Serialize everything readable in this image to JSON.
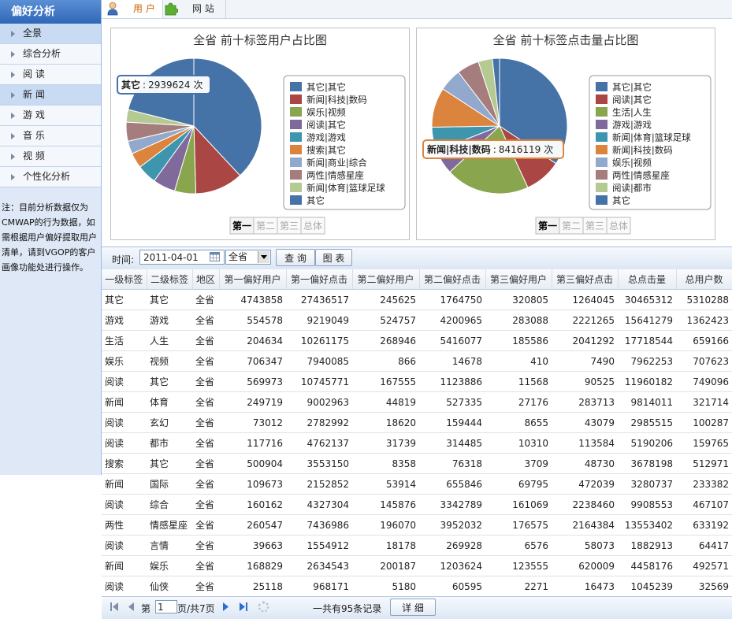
{
  "sidebar": {
    "title": "偏好分析",
    "items": [
      {
        "label": "全景",
        "active": true
      },
      {
        "label": "综合分析",
        "active": false
      },
      {
        "label": "阅 读",
        "active": false
      },
      {
        "label": "新 闻",
        "active": true
      },
      {
        "label": "游 戏",
        "active": false
      },
      {
        "label": "音 乐",
        "active": false
      },
      {
        "label": "视 频",
        "active": false
      },
      {
        "label": "个性化分析",
        "active": false
      }
    ],
    "note": "注：目前分析数据仅为CMWAP的行为数据，如需根据用户偏好提取用户清单，请到VGOP的客户画像功能处进行操作。"
  },
  "tabs": [
    {
      "label": "用 户",
      "icon": "person-icon",
      "active": true
    },
    {
      "label": "网 站",
      "icon": "puzzle-icon",
      "active": false
    }
  ],
  "chart_pager": [
    "第一",
    "第二",
    "第三",
    "总体"
  ],
  "chart_data": [
    {
      "type": "pie",
      "title": "全省 前十标签用户占比图",
      "labels": [
        "其它|其它",
        "新闻|科技|数码",
        "娱乐|视频",
        "阅读|其它",
        "游戏|游戏",
        "搜索|其它",
        "新闻|商业|综合",
        "两性|情感星座",
        "新闻|体育|篮球足球",
        "其它"
      ],
      "values": [
        5310288,
        1600000,
        707623,
        749096,
        650000,
        512971,
        430000,
        633192,
        420000,
        2939624
      ],
      "colors": [
        "#4572a7",
        "#aa4643",
        "#89a54e",
        "#80699b",
        "#3d96ae",
        "#db843d",
        "#92a8cd",
        "#a47d7c",
        "#b5ca92",
        "#4572a7"
      ],
      "tooltip": {
        "label": "其它",
        "value": "2939624",
        "unit": "次"
      },
      "legend": "right"
    },
    {
      "type": "pie",
      "title": "全省 前十标签点击量占比图",
      "labels": [
        "其它|其它",
        "阅读|其它",
        "生活|人生",
        "游戏|游戏",
        "新闻|体育|篮球足球",
        "新闻|科技|数码",
        "娱乐|视频",
        "两性|情感星座",
        "阅读|都市",
        "其它"
      ],
      "values": [
        30465312,
        7800000,
        17718544,
        5200000,
        5100000,
        8416119,
        4800000,
        4700000,
        3000000,
        1500000
      ],
      "colors": [
        "#4572a7",
        "#aa4643",
        "#89a54e",
        "#80699b",
        "#3d96ae",
        "#db843d",
        "#92a8cd",
        "#a47d7c",
        "#b5ca92",
        "#4572a7"
      ],
      "tooltip": {
        "label": "新闻|科技|数码",
        "value": "8416119",
        "unit": "次"
      },
      "legend": "right"
    }
  ],
  "toolbar": {
    "time_label": "时间:",
    "date_value": "2011-04-01",
    "region_value": "全省",
    "query_label": "查 询",
    "chart_label": "图 表"
  },
  "table": {
    "columns": [
      "一级标签",
      "二级标签",
      "地区",
      "第一偏好用户",
      "第一偏好点击",
      "第二偏好用户",
      "第二偏好点击",
      "第三偏好用户",
      "第三偏好点击",
      "总点击量",
      "总用户数"
    ],
    "rows": [
      [
        "其它",
        "其它",
        "全省",
        "4743858",
        "27436517",
        "245625",
        "1764750",
        "320805",
        "1264045",
        "30465312",
        "5310288"
      ],
      [
        "游戏",
        "游戏",
        "全省",
        "554578",
        "9219049",
        "524757",
        "4200965",
        "283088",
        "2221265",
        "15641279",
        "1362423"
      ],
      [
        "生活",
        "人生",
        "全省",
        "204634",
        "10261175",
        "268946",
        "5416077",
        "185586",
        "2041292",
        "17718544",
        "659166"
      ],
      [
        "娱乐",
        "视频",
        "全省",
        "706347",
        "7940085",
        "866",
        "14678",
        "410",
        "7490",
        "7962253",
        "707623"
      ],
      [
        "阅读",
        "其它",
        "全省",
        "569973",
        "10745771",
        "167555",
        "1123886",
        "11568",
        "90525",
        "11960182",
        "749096"
      ],
      [
        "新闻",
        "体育",
        "全省",
        "249719",
        "9002963",
        "44819",
        "527335",
        "27176",
        "283713",
        "9814011",
        "321714"
      ],
      [
        "阅读",
        "玄幻",
        "全省",
        "73012",
        "2782992",
        "18620",
        "159444",
        "8655",
        "43079",
        "2985515",
        "100287"
      ],
      [
        "阅读",
        "都市",
        "全省",
        "117716",
        "4762137",
        "31739",
        "314485",
        "10310",
        "113584",
        "5190206",
        "159765"
      ],
      [
        "搜索",
        "其它",
        "全省",
        "500904",
        "3553150",
        "8358",
        "76318",
        "3709",
        "48730",
        "3678198",
        "512971"
      ],
      [
        "新闻",
        "国际",
        "全省",
        "109673",
        "2152852",
        "53914",
        "655846",
        "69795",
        "472039",
        "3280737",
        "233382"
      ],
      [
        "阅读",
        "综合",
        "全省",
        "160162",
        "4327304",
        "145876",
        "3342789",
        "161069",
        "2238460",
        "9908553",
        "467107"
      ],
      [
        "两性",
        "情感星座",
        "全省",
        "260547",
        "7436986",
        "196070",
        "3952032",
        "176575",
        "2164384",
        "13553402",
        "633192"
      ],
      [
        "阅读",
        "言情",
        "全省",
        "39663",
        "1554912",
        "18178",
        "269928",
        "6576",
        "58073",
        "1882913",
        "64417"
      ],
      [
        "新闻",
        "娱乐",
        "全省",
        "168829",
        "2634543",
        "200187",
        "1203624",
        "123555",
        "620009",
        "4458176",
        "492571"
      ],
      [
        "阅读",
        "仙侠",
        "全省",
        "25118",
        "968171",
        "5180",
        "60595",
        "2271",
        "16473",
        "1045239",
        "32569"
      ]
    ]
  },
  "pager": {
    "prefix": "第",
    "page": "1",
    "suffix": "页/共7页",
    "total_text": "一共有95条记录",
    "detail_label": "详 细"
  }
}
